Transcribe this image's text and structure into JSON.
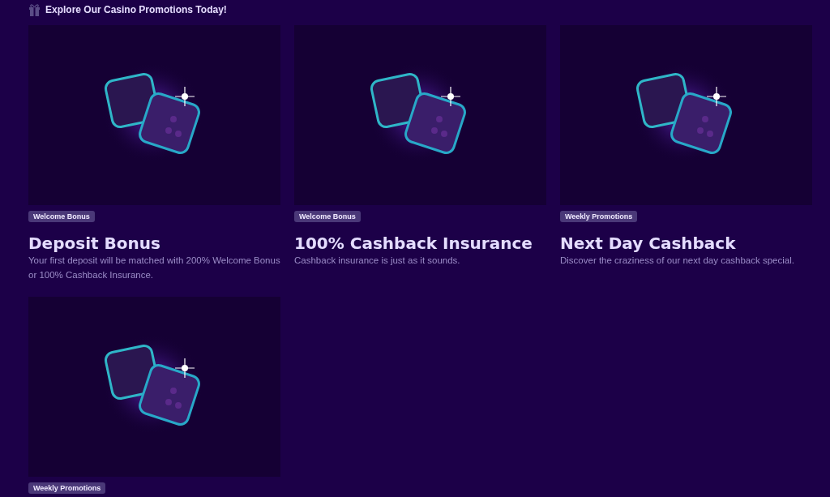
{
  "header": {
    "title": "Explore Our Casino Promotions Today!"
  },
  "promotions": [
    {
      "tag": "Welcome Bonus",
      "title": "Deposit Bonus",
      "description": "Your first deposit will be matched with 200% Welcome Bonus or 100% Cashback Insurance."
    },
    {
      "tag": "Welcome Bonus",
      "title": "100% Cashback Insurance",
      "description": "Cashback insurance is just as it sounds."
    },
    {
      "tag": "Weekly Promotions",
      "title": "Next Day Cashback",
      "description": "Discover the craziness of our next day cashback special."
    },
    {
      "tag": "Weekly Promotions"
    }
  ]
}
